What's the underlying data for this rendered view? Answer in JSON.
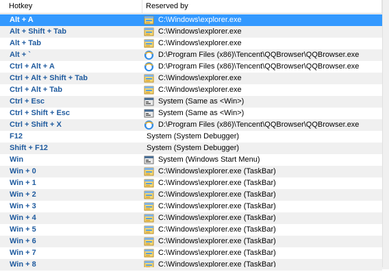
{
  "columns": {
    "hotkey": "Hotkey",
    "reserved_by": "Reserved by"
  },
  "selected_index": 0,
  "rows": [
    {
      "hotkey": "Alt + A",
      "reserved_by": "C:\\Windows\\explorer.exe",
      "icon": "explorer-icon"
    },
    {
      "hotkey": "Alt + Shift + Tab",
      "reserved_by": "C:\\Windows\\explorer.exe",
      "icon": "explorer-icon"
    },
    {
      "hotkey": "Alt + Tab",
      "reserved_by": "C:\\Windows\\explorer.exe",
      "icon": "explorer-icon"
    },
    {
      "hotkey": "Alt + `",
      "reserved_by": "D:\\Program Files (x86)\\Tencent\\QQBrowser\\QQBrowser.exe",
      "icon": "qqbrowser-icon"
    },
    {
      "hotkey": "Ctrl + Alt + A",
      "reserved_by": "D:\\Program Files (x86)\\Tencent\\QQBrowser\\QQBrowser.exe",
      "icon": "qqbrowser-icon"
    },
    {
      "hotkey": "Ctrl + Alt + Shift + Tab",
      "reserved_by": "C:\\Windows\\explorer.exe",
      "icon": "explorer-icon"
    },
    {
      "hotkey": "Ctrl + Alt + Tab",
      "reserved_by": "C:\\Windows\\explorer.exe",
      "icon": "explorer-icon"
    },
    {
      "hotkey": "Ctrl + Esc",
      "reserved_by": "System (Same as <Win>)",
      "icon": "system-window-icon"
    },
    {
      "hotkey": "Ctrl + Shift + Esc",
      "reserved_by": "System (Same as <Win>)",
      "icon": "system-window-icon"
    },
    {
      "hotkey": "Ctrl + Shift + X",
      "reserved_by": "D:\\Program Files (x86)\\Tencent\\QQBrowser\\QQBrowser.exe",
      "icon": "qqbrowser-icon"
    },
    {
      "hotkey": "F12",
      "reserved_by": "System (System Debugger)",
      "icon": ""
    },
    {
      "hotkey": "Shift + F12",
      "reserved_by": "System (System Debugger)",
      "icon": ""
    },
    {
      "hotkey": "Win",
      "reserved_by": "System (Windows Start Menu)",
      "icon": "system-window-icon"
    },
    {
      "hotkey": "Win + 0",
      "reserved_by": "C:\\Windows\\explorer.exe (TaskBar)",
      "icon": "explorer-icon"
    },
    {
      "hotkey": "Win + 1",
      "reserved_by": "C:\\Windows\\explorer.exe (TaskBar)",
      "icon": "explorer-icon"
    },
    {
      "hotkey": "Win + 2",
      "reserved_by": "C:\\Windows\\explorer.exe (TaskBar)",
      "icon": "explorer-icon"
    },
    {
      "hotkey": "Win + 3",
      "reserved_by": "C:\\Windows\\explorer.exe (TaskBar)",
      "icon": "explorer-icon"
    },
    {
      "hotkey": "Win + 4",
      "reserved_by": "C:\\Windows\\explorer.exe (TaskBar)",
      "icon": "explorer-icon"
    },
    {
      "hotkey": "Win + 5",
      "reserved_by": "C:\\Windows\\explorer.exe (TaskBar)",
      "icon": "explorer-icon"
    },
    {
      "hotkey": "Win + 6",
      "reserved_by": "C:\\Windows\\explorer.exe (TaskBar)",
      "icon": "explorer-icon"
    },
    {
      "hotkey": "Win + 7",
      "reserved_by": "C:\\Windows\\explorer.exe (TaskBar)",
      "icon": "explorer-icon"
    },
    {
      "hotkey": "Win + 8",
      "reserved_by": "C:\\Windows\\explorer.exe (TaskBar)",
      "icon": "explorer-icon"
    }
  ],
  "colors": {
    "selection": "#3399ff",
    "hotkey_text": "#1e5a9e",
    "alt_row": "#f0f0f0"
  }
}
